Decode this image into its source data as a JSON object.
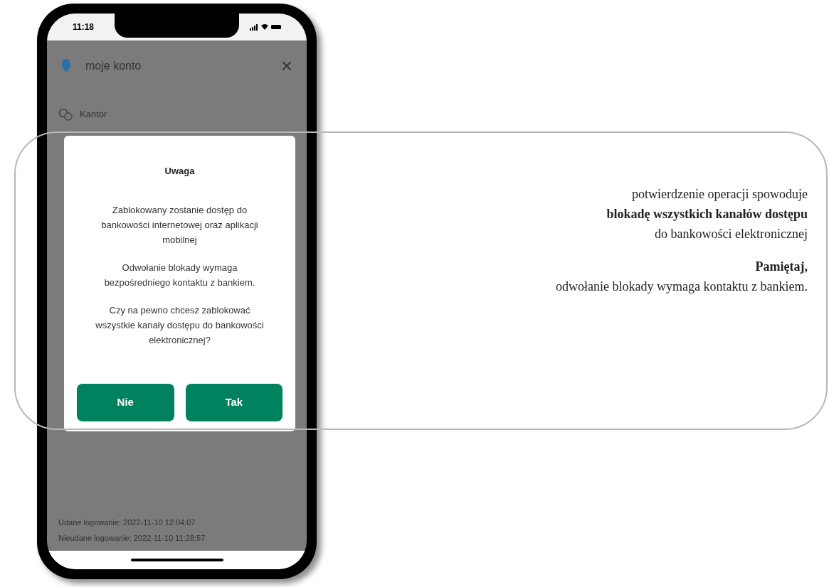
{
  "phone": {
    "status_bar": {
      "time": "11:18"
    },
    "header": {
      "title": "moje konto",
      "close": "×"
    },
    "menu_items": [
      {
        "label": "Kantor"
      }
    ],
    "login_info": [
      "Udane logowanie: 2022-11-10 12:04:07",
      "Nieudane logowanie: 2022-11-10 11:28:57"
    ],
    "dialog": {
      "title": "Uwaga",
      "paragraphs": [
        "Zablokowany zostanie dostęp do bankowości internetowej oraz aplikacji mobilnej",
        "Odwołanie blokady wymaga bezpośredniego kontaktu z bankiem.",
        "Czy na pewno chcesz zablokować wszystkie kanały dostępu do bankowości elektronicznej?"
      ],
      "buttons": [
        {
          "label": "Nie"
        },
        {
          "label": "Tak"
        }
      ]
    }
  },
  "annotation": {
    "paragraphs": [
      [
        {
          "text": "potwierdzenie operacji spowoduje",
          "bold": false
        },
        {
          "text": "blokadę wszystkich kanałów dostępu",
          "bold": true
        },
        {
          "text": "do bankowości elektronicznej",
          "bold": false
        }
      ],
      [
        {
          "text": "Pamiętaj,",
          "bold": true
        },
        {
          "text": "odwołanie blokady wymaga kontaktu z bankiem.",
          "bold": false
        }
      ]
    ]
  }
}
